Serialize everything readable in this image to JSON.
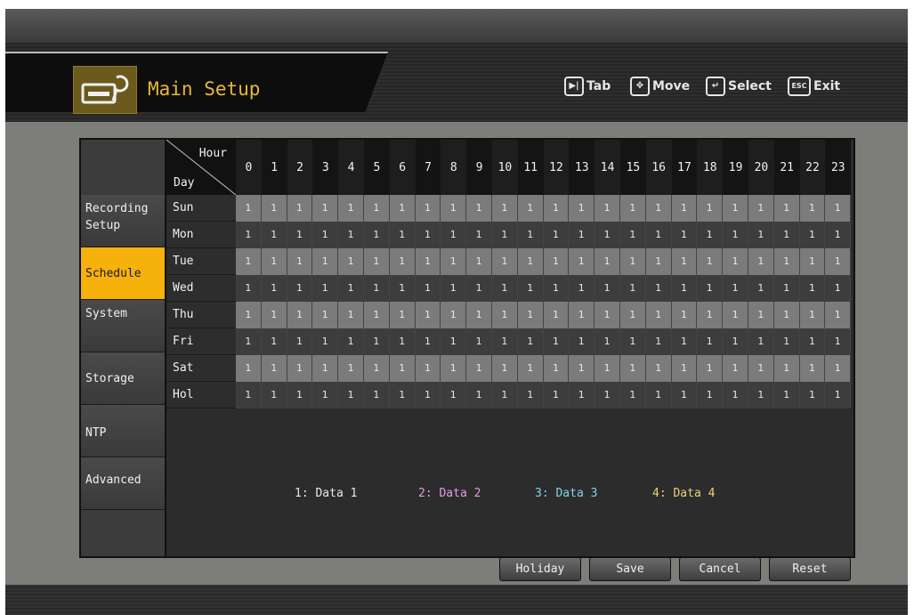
{
  "header": {
    "title": "Main Setup",
    "help": [
      {
        "icon": "tab-key-icon",
        "glyph": "▶|",
        "label": "Tab"
      },
      {
        "icon": "move-arrows-icon",
        "glyph": "✥",
        "label": "Move"
      },
      {
        "icon": "select-enter-icon",
        "glyph": "↵",
        "label": "Select"
      },
      {
        "icon": "esc-key-icon",
        "glyph": "ESC",
        "label": "Exit"
      }
    ]
  },
  "sidebar": {
    "items": [
      {
        "label": "Recording Setup"
      },
      {
        "label": "Schedule",
        "active": true
      },
      {
        "label": "System"
      },
      {
        "label": "Storage"
      },
      {
        "label": "NTP"
      },
      {
        "label": "Advanced"
      }
    ]
  },
  "table": {
    "hour_label": "Hour",
    "day_label": "Day",
    "hours": [
      "0",
      "1",
      "2",
      "3",
      "4",
      "5",
      "6",
      "7",
      "8",
      "9",
      "10",
      "11",
      "12",
      "13",
      "14",
      "15",
      "16",
      "17",
      "18",
      "19",
      "20",
      "21",
      "22",
      "23"
    ],
    "rows": [
      {
        "day": "Sun",
        "values": [
          "1",
          "1",
          "1",
          "1",
          "1",
          "1",
          "1",
          "1",
          "1",
          "1",
          "1",
          "1",
          "1",
          "1",
          "1",
          "1",
          "1",
          "1",
          "1",
          "1",
          "1",
          "1",
          "1",
          "1"
        ]
      },
      {
        "day": "Mon",
        "values": [
          "1",
          "1",
          "1",
          "1",
          "1",
          "1",
          "1",
          "1",
          "1",
          "1",
          "1",
          "1",
          "1",
          "1",
          "1",
          "1",
          "1",
          "1",
          "1",
          "1",
          "1",
          "1",
          "1",
          "1"
        ]
      },
      {
        "day": "Tue",
        "values": [
          "1",
          "1",
          "1",
          "1",
          "1",
          "1",
          "1",
          "1",
          "1",
          "1",
          "1",
          "1",
          "1",
          "1",
          "1",
          "1",
          "1",
          "1",
          "1",
          "1",
          "1",
          "1",
          "1",
          "1"
        ]
      },
      {
        "day": "Wed",
        "values": [
          "1",
          "1",
          "1",
          "1",
          "1",
          "1",
          "1",
          "1",
          "1",
          "1",
          "1",
          "1",
          "1",
          "1",
          "1",
          "1",
          "1",
          "1",
          "1",
          "1",
          "1",
          "1",
          "1",
          "1"
        ]
      },
      {
        "day": "Thu",
        "values": [
          "1",
          "1",
          "1",
          "1",
          "1",
          "1",
          "1",
          "1",
          "1",
          "1",
          "1",
          "1",
          "1",
          "1",
          "1",
          "1",
          "1",
          "1",
          "1",
          "1",
          "1",
          "1",
          "1",
          "1"
        ]
      },
      {
        "day": "Fri",
        "values": [
          "1",
          "1",
          "1",
          "1",
          "1",
          "1",
          "1",
          "1",
          "1",
          "1",
          "1",
          "1",
          "1",
          "1",
          "1",
          "1",
          "1",
          "1",
          "1",
          "1",
          "1",
          "1",
          "1",
          "1"
        ]
      },
      {
        "day": "Sat",
        "values": [
          "1",
          "1",
          "1",
          "1",
          "1",
          "1",
          "1",
          "1",
          "1",
          "1",
          "1",
          "1",
          "1",
          "1",
          "1",
          "1",
          "1",
          "1",
          "1",
          "1",
          "1",
          "1",
          "1",
          "1"
        ]
      },
      {
        "day": "Hol",
        "values": [
          "1",
          "1",
          "1",
          "1",
          "1",
          "1",
          "1",
          "1",
          "1",
          "1",
          "1",
          "1",
          "1",
          "1",
          "1",
          "1",
          "1",
          "1",
          "1",
          "1",
          "1",
          "1",
          "1",
          "1"
        ]
      }
    ]
  },
  "legend": [
    {
      "label": "1: Data 1",
      "color": "#e8e8e8"
    },
    {
      "label": "2: Data 2",
      "color": "#e59ae8"
    },
    {
      "label": "3: Data 3",
      "color": "#7fd6e0"
    },
    {
      "label": "4: Data 4",
      "color": "#ecd27a"
    }
  ],
  "buttons": {
    "holiday": "Holiday",
    "save": "Save",
    "cancel": "Cancel",
    "reset": "Reset"
  },
  "colors": {
    "accent": "#f6b10a",
    "title": "#e9b93a"
  }
}
